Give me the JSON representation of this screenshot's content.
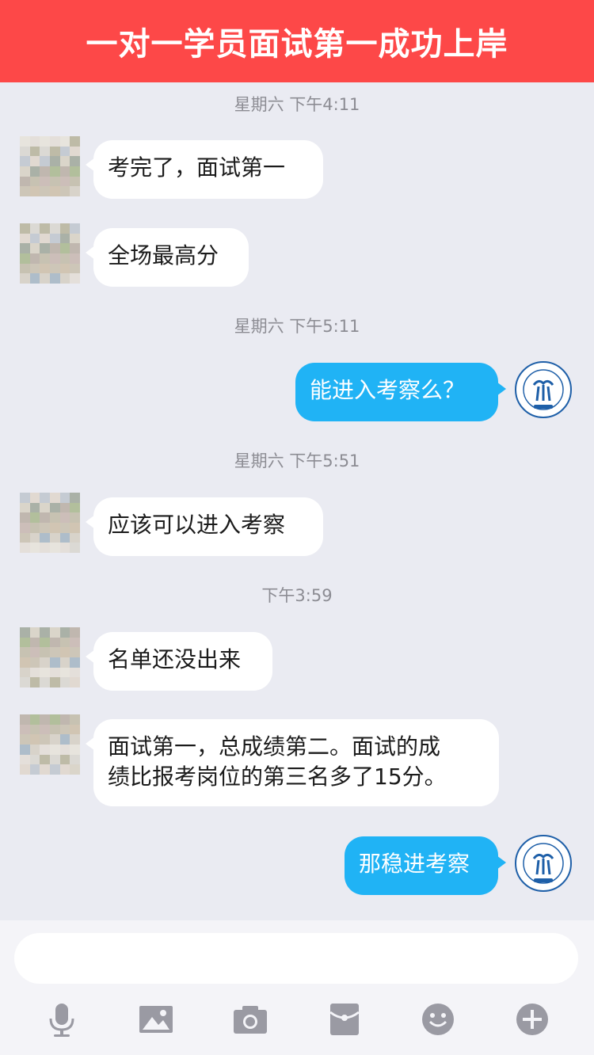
{
  "banner": {
    "title": "一对一学员面试第一成功上岸"
  },
  "messages": {
    "ts1": "星期六 下午4:11",
    "m1": "考完了，面试第一",
    "m2": "全场最高分",
    "ts2": "星期六 下午5:11",
    "m3": "能进入考察么？",
    "ts3": "星期六 下午5:51",
    "m4": "应该可以进入考察",
    "ts4": "下午3:59",
    "m5": "名单还没出来",
    "m6": "面试第一，总成绩第二。面试的成\n绩比报考岗位的第三名多了15分。",
    "m7": "那稳进考察"
  },
  "colors": {
    "banner": "#FD4848",
    "outgoing_bubble": "#20B3F5",
    "incoming_bubble": "#FFFFFF",
    "chat_bg": "#EAEBF2",
    "logo": "#1E5FA8"
  },
  "toolbar": {
    "icons": [
      "microphone-icon",
      "image-icon",
      "camera-icon",
      "red-packet-icon",
      "emoji-icon",
      "plus-icon"
    ]
  }
}
